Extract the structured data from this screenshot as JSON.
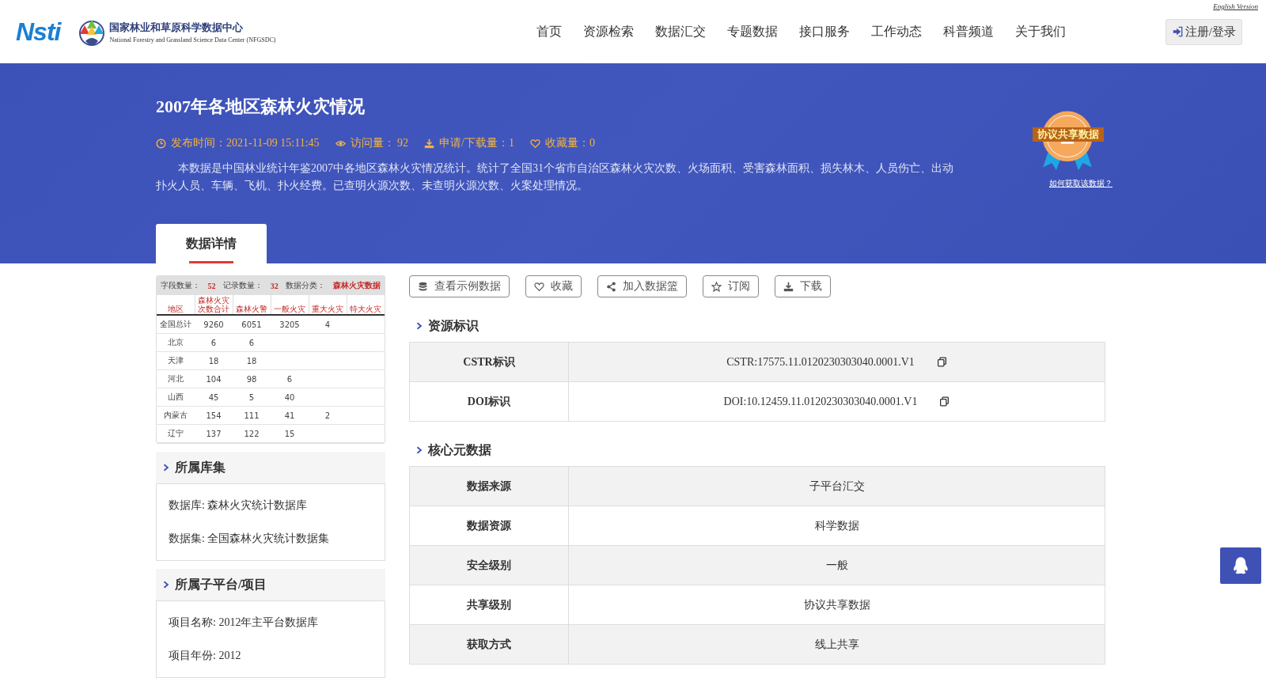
{
  "header": {
    "logo_text": "Nsti",
    "org_name": "国家林业和草原科学数据中心",
    "org_name_en": "National Forestry and Grassland Science Data Center (NFGSDC)",
    "english_link": "English Version",
    "login_button": "注册/登录"
  },
  "nav": [
    "首页",
    "资源检索",
    "数据汇交",
    "专题数据",
    "接口服务",
    "工作动态",
    "科普频道",
    "关于我们"
  ],
  "dataset": {
    "title": "2007年各地区森林火灾情况",
    "meta": [
      {
        "kind": "time",
        "text": "发布时间：2021-11-09 15:11:45"
      },
      {
        "kind": "views",
        "text": "访问量： 92"
      },
      {
        "kind": "downloads",
        "text": "申请/下载量：1"
      },
      {
        "kind": "favorites",
        "text": "收藏量：0"
      }
    ],
    "description": "本数据是中国林业统计年鉴2007中各地区森林火灾情况统计。统计了全国31个省市自治区森林火灾次数、火场面积、受害森林面积、损失林木、人员伤亡、出动扑火人员、车辆、飞机、扑火经费。已查明火源次数、未查明火源次数、火案处理情况。",
    "badge": {
      "label": "协议共享数据",
      "link": "如何获取该数据？"
    }
  },
  "tabs": [
    {
      "label": "数据详情",
      "selected": true
    }
  ],
  "preview": {
    "summary": [
      {
        "label": "字段数量：",
        "value": "52"
      },
      {
        "label": "记录数量：",
        "value": "32"
      },
      {
        "label": "数据分类：",
        "value": "森林火灾数据"
      }
    ],
    "columns": [
      "地区",
      "森林火灾次数合计",
      "森林火警",
      "一般火灾",
      "重大火灾",
      "特大火灾"
    ],
    "rows": [
      [
        "全国总计",
        "9260",
        "6051",
        "3205",
        "4",
        null
      ],
      [
        "北京",
        "6",
        "6",
        null,
        null,
        null
      ],
      [
        "天津",
        "18",
        "18",
        null,
        null,
        null
      ],
      [
        "河北",
        "104",
        "98",
        "6",
        null,
        null
      ],
      [
        "山西",
        "45",
        "5",
        "40",
        null,
        null
      ],
      [
        "内蒙古",
        "154",
        "111",
        "41",
        "2",
        null
      ],
      [
        "辽宁",
        "137",
        "122",
        "15",
        null,
        null
      ]
    ]
  },
  "sidebar_sections": [
    {
      "title": "所属库集",
      "items": [
        "数据库: 森林火灾统计数据库",
        "数据集: 全国森林火灾统计数据集"
      ]
    },
    {
      "title": "所属子平台/项目",
      "items": [
        "项目名称: 2012年主平台数据库",
        "项目年份: 2012"
      ]
    }
  ],
  "actions": [
    {
      "kind": "database",
      "label": "查看示例数据"
    },
    {
      "kind": "heart",
      "label": "收藏"
    },
    {
      "kind": "share",
      "label": "加入数据篮"
    },
    {
      "kind": "star",
      "label": "订阅"
    },
    {
      "kind": "download",
      "label": "下载"
    }
  ],
  "sections": [
    {
      "title": "资源标识",
      "rows": [
        {
          "label": "CSTR标识",
          "value": "CSTR:17575.11.0120230303040.0001.V1",
          "copyable": true
        },
        {
          "label": "DOI标识",
          "value": "DOI:10.12459.11.0120230303040.0001.V1",
          "copyable": true
        }
      ]
    },
    {
      "title": "核心元数据",
      "rows": [
        {
          "label": "数据来源",
          "value": "子平台汇交",
          "copyable": false
        },
        {
          "label": "数据资源",
          "value": "科学数据",
          "copyable": false
        },
        {
          "label": "安全级别",
          "value": "一般",
          "copyable": false
        },
        {
          "label": "共享级别",
          "value": "协议共享数据",
          "copyable": false
        },
        {
          "label": "获取方式",
          "value": "线上共享",
          "copyable": false
        }
      ]
    }
  ]
}
